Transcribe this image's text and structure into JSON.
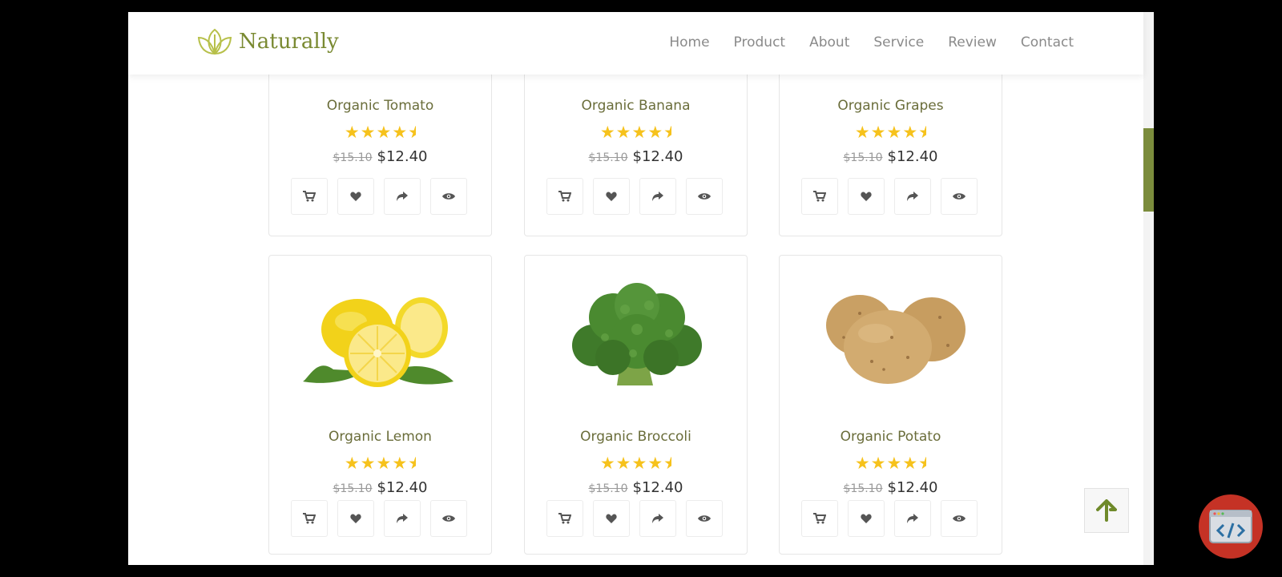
{
  "brand": {
    "name": "Naturally",
    "logo_icon": "leaf-logo-icon",
    "accent_color": "#7b8c3c"
  },
  "nav": {
    "items": [
      "Home",
      "Product",
      "About",
      "Service",
      "Review",
      "Contact"
    ]
  },
  "products_top": [
    {
      "name": "Organic Tomato",
      "rating": 4.5,
      "old_price": "$15.10",
      "price": "$12.40"
    },
    {
      "name": "Organic Banana",
      "rating": 4.5,
      "old_price": "$15.10",
      "price": "$12.40"
    },
    {
      "name": "Organic Grapes",
      "rating": 4.5,
      "old_price": "$15.10",
      "price": "$12.40"
    }
  ],
  "products_bottom": [
    {
      "name": "Organic Lemon",
      "rating": 4.5,
      "old_price": "$15.10",
      "price": "$12.40",
      "image": "lemon"
    },
    {
      "name": "Organic Broccoli",
      "rating": 4.5,
      "old_price": "$15.10",
      "price": "$12.40",
      "image": "broccoli"
    },
    {
      "name": "Organic Potato",
      "rating": 4.5,
      "old_price": "$15.10",
      "price": "$12.40",
      "image": "potato"
    }
  ],
  "card_actions": [
    "cart-icon",
    "heart-icon",
    "share-icon",
    "eye-icon"
  ],
  "colors": {
    "star": "#f6c21c",
    "product_name": "#6a6d3a",
    "badge": "#c53225"
  },
  "scroll_top_icon": "arrow-up-icon",
  "overlay_badge_icon": "code-icon"
}
